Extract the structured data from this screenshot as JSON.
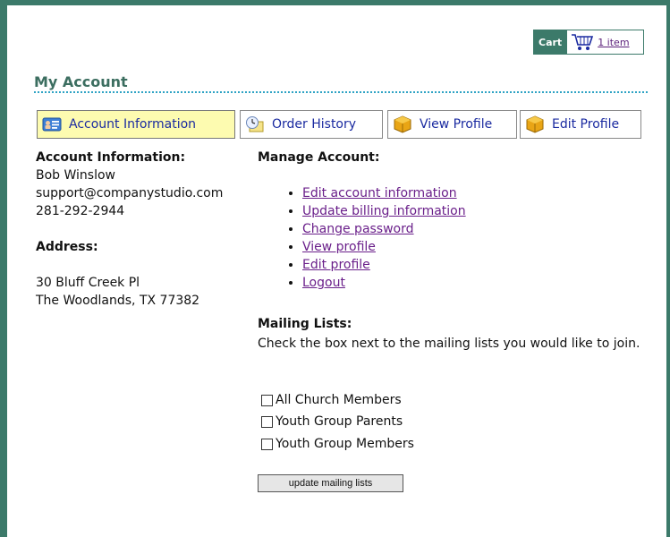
{
  "cart": {
    "label": "Cart",
    "icon": "cart-icon",
    "link_text": "1 item"
  },
  "page": {
    "title": "My Account"
  },
  "tabs": [
    {
      "label": "Account Information",
      "icon": "id-card-icon",
      "active": true
    },
    {
      "label": "Order History",
      "icon": "clock-icon",
      "active": false
    },
    {
      "label": "View Profile",
      "icon": "box-icon",
      "active": false
    },
    {
      "label": "Edit Profile",
      "icon": "box-icon",
      "active": false
    }
  ],
  "account_info": {
    "heading": "Account Information:",
    "name": "Bob Winslow",
    "email": "support@companystudio.com",
    "phone": "281-292-2944"
  },
  "address": {
    "heading": "Address:",
    "line1": "30 Bluff Creek Pl",
    "line2": "The Woodlands, TX 77382"
  },
  "manage": {
    "heading": "Manage Account:",
    "links": [
      "Edit account information",
      "Update billing information",
      "Change password",
      "View profile",
      "Edit profile",
      "Logout"
    ]
  },
  "mailing": {
    "heading": "Mailing Lists:",
    "description": "Check the box next to the mailing lists you would like to join.",
    "lists": [
      {
        "label": "All Church Members",
        "checked": false
      },
      {
        "label": "Youth Group Parents",
        "checked": false
      },
      {
        "label": "Youth Group Members",
        "checked": false
      }
    ],
    "button": "update mailing lists"
  },
  "colors": {
    "frame": "#3c7a6a",
    "active_tab": "#fdfbb0",
    "link": "#6a1f8a",
    "tab_text": "#1a2aa0"
  }
}
